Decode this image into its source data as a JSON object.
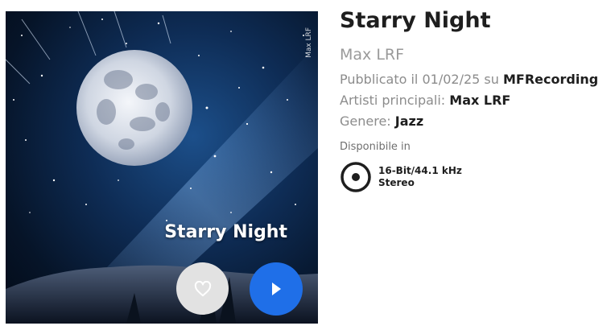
{
  "cover": {
    "watermark": "Max LRF",
    "title": "Starry Night",
    "favorite_icon": "heart-icon",
    "play_icon": "play-icon"
  },
  "album": {
    "title": "Starry Night",
    "artist": "Max LRF",
    "published_prefix": "Pubblicato il",
    "published_date": "01/02/25",
    "published_on": "su",
    "label": "MFRecording",
    "main_artists_prefix": "Artisti principali:",
    "main_artists": "Max LRF",
    "genre_prefix": "Genere:",
    "genre": "Jazz"
  },
  "availability": {
    "label": "Disponibile in",
    "icon": "disc-icon",
    "format": "16-Bit/44.1 kHz",
    "channels": "Stereo"
  },
  "colors": {
    "play_button": "#1f6fe8",
    "favorite_button": "#e2e2e2"
  }
}
